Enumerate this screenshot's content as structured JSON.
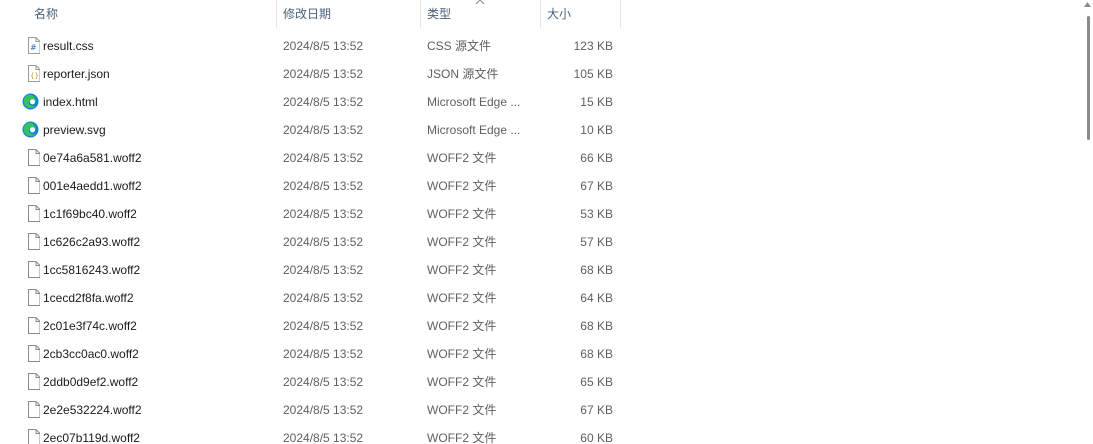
{
  "columns": {
    "name": "名称",
    "date": "修改日期",
    "type": "类型",
    "size": "大小"
  },
  "sort": {
    "column": "type",
    "direction": "ascending",
    "icon": "chevron-up-icon"
  },
  "files": [
    {
      "name": "result.css",
      "date": "2024/8/5 13:52",
      "type": "CSS 源文件",
      "size": "123 KB",
      "icon": "css-file-icon"
    },
    {
      "name": "reporter.json",
      "date": "2024/8/5 13:52",
      "type": "JSON 源文件",
      "size": "105 KB",
      "icon": "json-file-icon"
    },
    {
      "name": "index.html",
      "date": "2024/8/5 13:52",
      "type": "Microsoft Edge ...",
      "size": "15 KB",
      "icon": "edge-icon"
    },
    {
      "name": "preview.svg",
      "date": "2024/8/5 13:52",
      "type": "Microsoft Edge ...",
      "size": "10 KB",
      "icon": "edge-icon"
    },
    {
      "name": "0e74a6a581.woff2",
      "date": "2024/8/5 13:52",
      "type": "WOFF2 文件",
      "size": "66 KB",
      "icon": "blank-file-icon"
    },
    {
      "name": "001e4aedd1.woff2",
      "date": "2024/8/5 13:52",
      "type": "WOFF2 文件",
      "size": "67 KB",
      "icon": "blank-file-icon"
    },
    {
      "name": "1c1f69bc40.woff2",
      "date": "2024/8/5 13:52",
      "type": "WOFF2 文件",
      "size": "53 KB",
      "icon": "blank-file-icon"
    },
    {
      "name": "1c626c2a93.woff2",
      "date": "2024/8/5 13:52",
      "type": "WOFF2 文件",
      "size": "57 KB",
      "icon": "blank-file-icon"
    },
    {
      "name": "1cc5816243.woff2",
      "date": "2024/8/5 13:52",
      "type": "WOFF2 文件",
      "size": "68 KB",
      "icon": "blank-file-icon"
    },
    {
      "name": "1cecd2f8fa.woff2",
      "date": "2024/8/5 13:52",
      "type": "WOFF2 文件",
      "size": "64 KB",
      "icon": "blank-file-icon"
    },
    {
      "name": "2c01e3f74c.woff2",
      "date": "2024/8/5 13:52",
      "type": "WOFF2 文件",
      "size": "68 KB",
      "icon": "blank-file-icon"
    },
    {
      "name": "2cb3cc0ac0.woff2",
      "date": "2024/8/5 13:52",
      "type": "WOFF2 文件",
      "size": "68 KB",
      "icon": "blank-file-icon"
    },
    {
      "name": "2ddb0d9ef2.woff2",
      "date": "2024/8/5 13:52",
      "type": "WOFF2 文件",
      "size": "65 KB",
      "icon": "blank-file-icon"
    },
    {
      "name": "2e2e532224.woff2",
      "date": "2024/8/5 13:52",
      "type": "WOFF2 文件",
      "size": "67 KB",
      "icon": "blank-file-icon"
    },
    {
      "name": "2ec07b119d.woff2",
      "date": "2024/8/5 13:52",
      "type": "WOFF2 文件",
      "size": "60 KB",
      "icon": "blank-file-icon"
    }
  ],
  "colors": {
    "header_text": "#4c607a",
    "name_text": "#1b1b1b",
    "meta_text": "#5f5f5f",
    "edge_blue": "#1383d7",
    "edge_green": "#38c15f"
  }
}
